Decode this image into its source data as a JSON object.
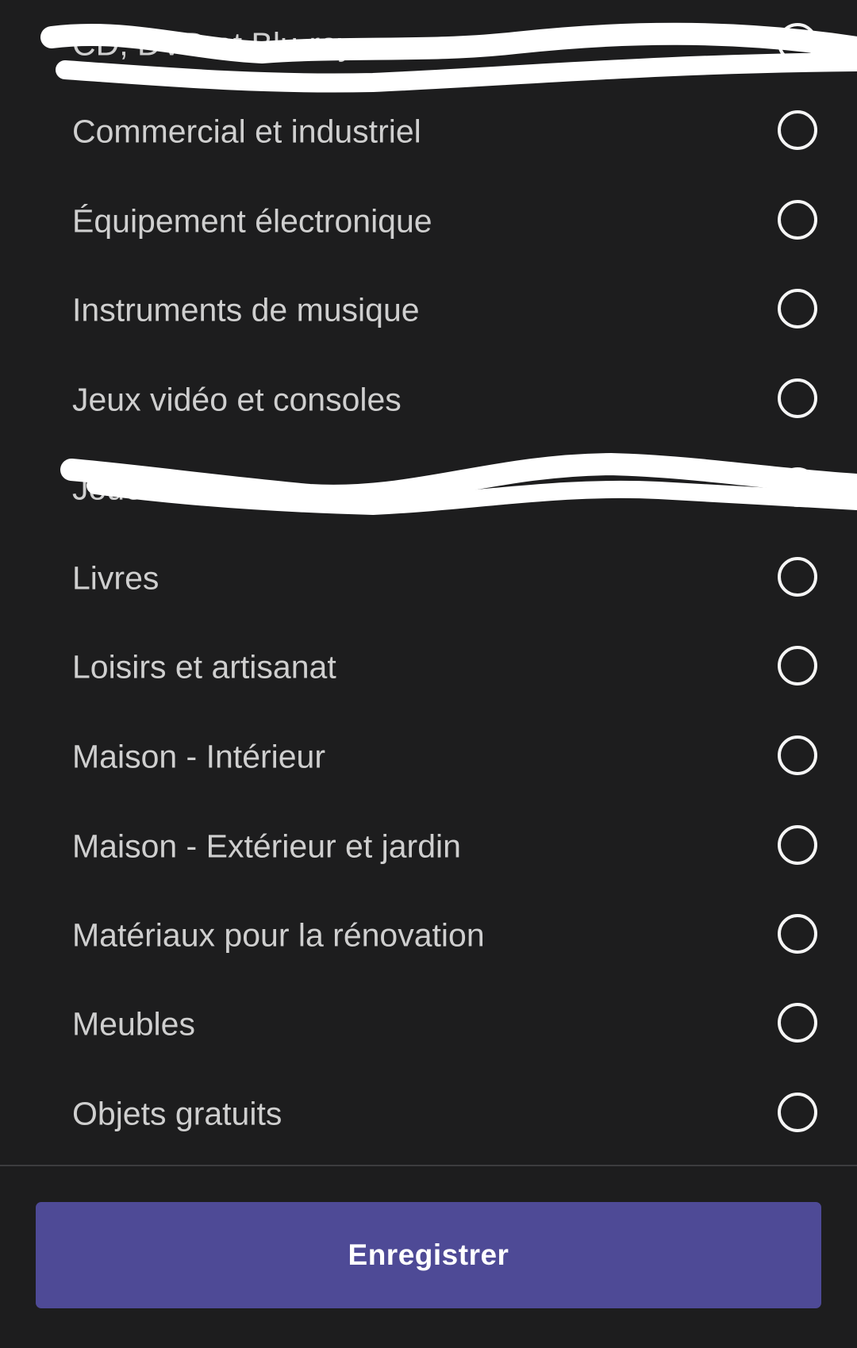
{
  "categories": [
    {
      "label": "CD, DVD et Blu-ray",
      "selected": false,
      "redacted": true
    },
    {
      "label": "Commercial et industriel",
      "selected": false
    },
    {
      "label": "Équipement électronique",
      "selected": false
    },
    {
      "label": "Instruments de musique",
      "selected": false
    },
    {
      "label": "Jeux vidéo et consoles",
      "selected": false
    },
    {
      "label": "Jouets et jeux",
      "selected": false,
      "redacted": true
    },
    {
      "label": "Livres",
      "selected": false
    },
    {
      "label": "Loisirs et artisanat",
      "selected": false
    },
    {
      "label": "Maison - Intérieur",
      "selected": false
    },
    {
      "label": "Maison - Extérieur et jardin",
      "selected": false
    },
    {
      "label": "Matériaux pour la rénovation",
      "selected": false
    },
    {
      "label": "Meubles",
      "selected": false
    },
    {
      "label": "Objets gratuits",
      "selected": false
    }
  ],
  "footer": {
    "save_label": "Enregistrer"
  },
  "colors": {
    "background": "#1d1d1e",
    "text": "#cfcfcf",
    "radio": "#f5f5f5",
    "button": "#4e4a96",
    "redaction": "#ffffff"
  }
}
